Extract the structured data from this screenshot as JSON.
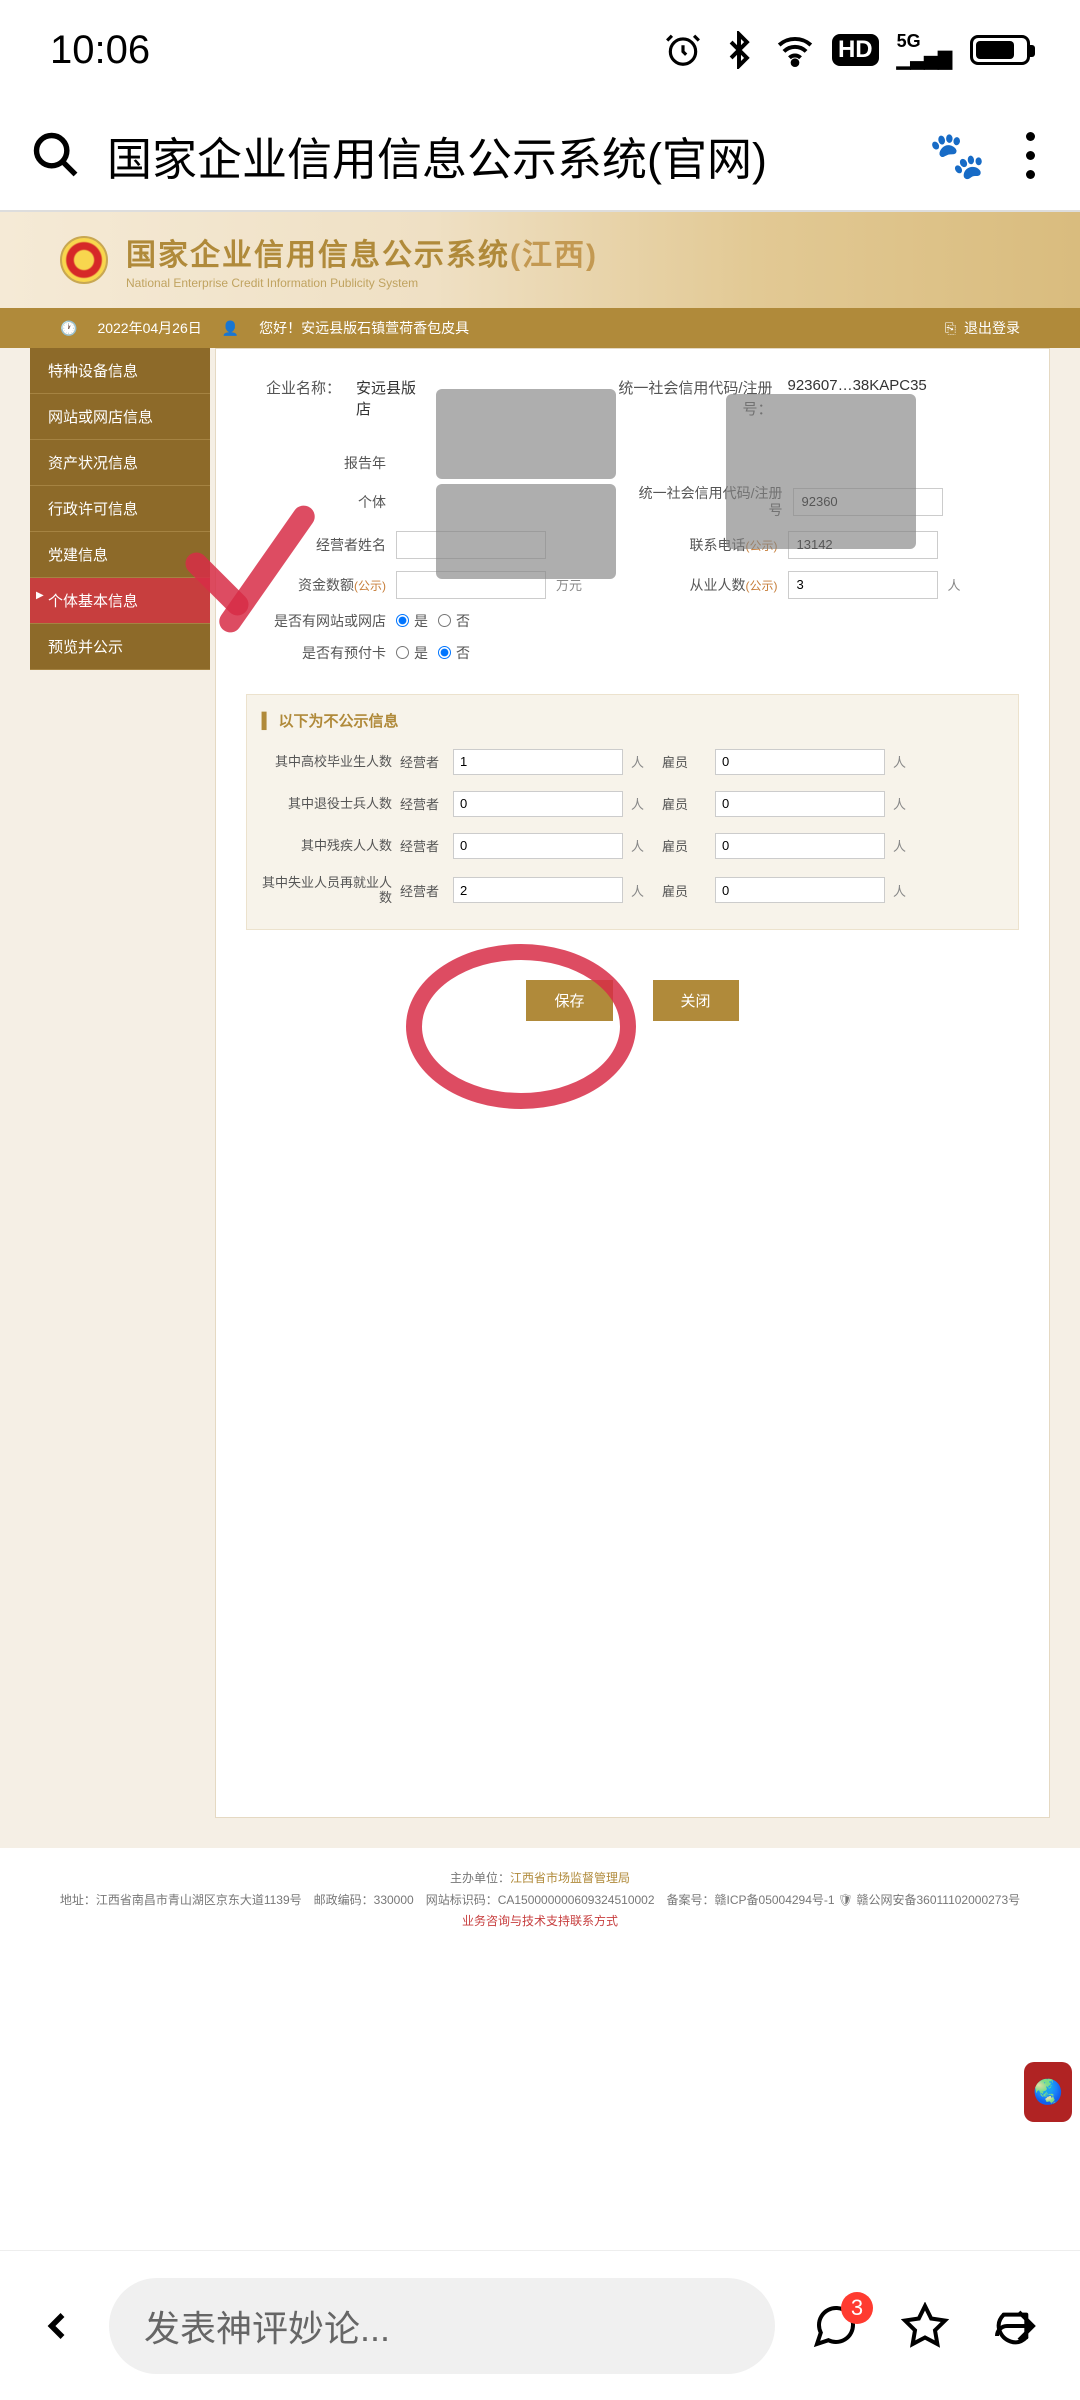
{
  "status": {
    "time": "10:06",
    "network": "5G"
  },
  "browser": {
    "title": "国家企业信用信息公示系统(官网)"
  },
  "site": {
    "title": "国家企业信用信息公示系统",
    "province": "(江西)",
    "subtitle": "National Enterprise Credit Information Publicity System"
  },
  "infobar": {
    "date": "2022年04月26日",
    "greet": "您好！安远县版石镇萱荷香包皮具",
    "logout": "退出登录"
  },
  "sidebar": {
    "items": [
      "特种设备信息",
      "网站或网店信息",
      "资产状况信息",
      "行政许可信息",
      "党建信息",
      "个体基本信息",
      "预览并公示"
    ],
    "active_index": 5
  },
  "header_fields": {
    "company_label": "企业名称：",
    "company_value": "安远县版",
    "company_suffix": "店",
    "credit_label": "统一社会信用代码/注册号：",
    "credit_value": "923607",
    "credit_suffix": "38KAPC35"
  },
  "form": {
    "report_year_label": "报告年",
    "indiv_label": "个体",
    "credit2_label": "统一社会信用代码/注册号",
    "credit2_value": "92360",
    "owner_label": "经营者姓名",
    "phone_label": "联系电话",
    "phone_publicity": "(公示)",
    "phone_value": "13142",
    "capital_label": "资金数额",
    "capital_publicity": "(公示)",
    "capital_unit": "万元",
    "employee_label": "从业人数",
    "employee_publicity": "(公示)",
    "employee_value": "3",
    "employee_unit": "人",
    "website_label": "是否有网站或网店",
    "yes": "是",
    "no": "否",
    "prepaid_label": "是否有预付卡"
  },
  "nonpublic": {
    "heading": "以下为不公示信息",
    "rows": [
      {
        "label": "其中高校毕业生人数",
        "op": "经营者",
        "op_val": "1",
        "hire": "雇员",
        "hire_val": "0"
      },
      {
        "label": "其中退役士兵人数",
        "op": "经营者",
        "op_val": "0",
        "hire": "雇员",
        "hire_val": "0"
      },
      {
        "label": "其中残疾人人数",
        "op": "经营者",
        "op_val": "0",
        "hire": "雇员",
        "hire_val": "0"
      },
      {
        "label": "其中失业人员再就业人数",
        "op": "经营者",
        "op_val": "2",
        "hire": "雇员",
        "hire_val": "0"
      }
    ],
    "unit": "人"
  },
  "buttons": {
    "save": "保存",
    "close": "关闭"
  },
  "footer": {
    "org_label": "主办单位：",
    "org": "江西省市场监督管理局",
    "addr": "地址：江西省南昌市青山湖区京东大道1139号　邮政编码：330000　网站标识码：CA150000000609324510002　备案号：赣ICP备05004294号-1",
    "record": "赣公网安备36011102000273号",
    "contact": "业务咨询与技术支持联系方式"
  },
  "bottom": {
    "comment_placeholder": "发表神评妙论...",
    "badge": "3"
  }
}
